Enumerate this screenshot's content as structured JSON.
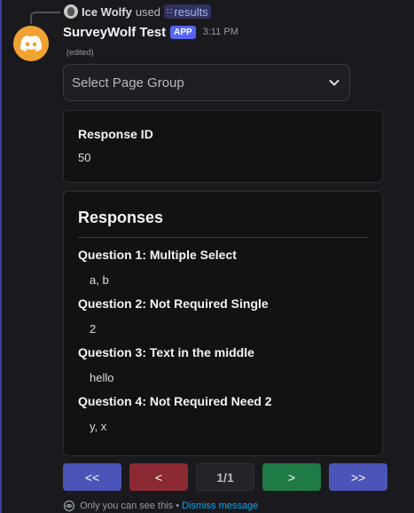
{
  "reply": {
    "user_name": "Ice Wolfy",
    "used_text": "used",
    "command_name": "results"
  },
  "message": {
    "bot_name": "SurveyWolf Test",
    "app_tag": "APP",
    "timestamp": "3:11 PM",
    "edited_label": "(edited)"
  },
  "select": {
    "placeholder": "Select Page Group"
  },
  "response_id": {
    "label": "Response ID",
    "value": "50"
  },
  "responses": {
    "title": "Responses",
    "questions": [
      {
        "label": "Question 1: Multiple Select",
        "answer": "a, b"
      },
      {
        "label": "Question 2: Not Required Single",
        "answer": "2"
      },
      {
        "label": "Question 3: Text in the middle",
        "answer": "hello"
      },
      {
        "label": "Question 4: Not Required Need 2",
        "answer": "y, x"
      }
    ]
  },
  "pagination": {
    "first": "<<",
    "prev": "<",
    "page": "1/1",
    "next": ">",
    "last": ">>"
  },
  "ephemeral": {
    "notice": "Only you can see this •",
    "dismiss": "Dismiss message"
  },
  "colors": {
    "accent_blue": "#5865f2",
    "avatar_orange": "#f0a232",
    "button_red": "#8b2a33",
    "button_green": "#1f7a45",
    "link_blue": "#00a8fc"
  },
  "icons": {
    "avatar": "discord-logo-icon",
    "command": "slash-command-icon",
    "select": "chevron-down-icon",
    "ephemeral": "eye-icon"
  }
}
